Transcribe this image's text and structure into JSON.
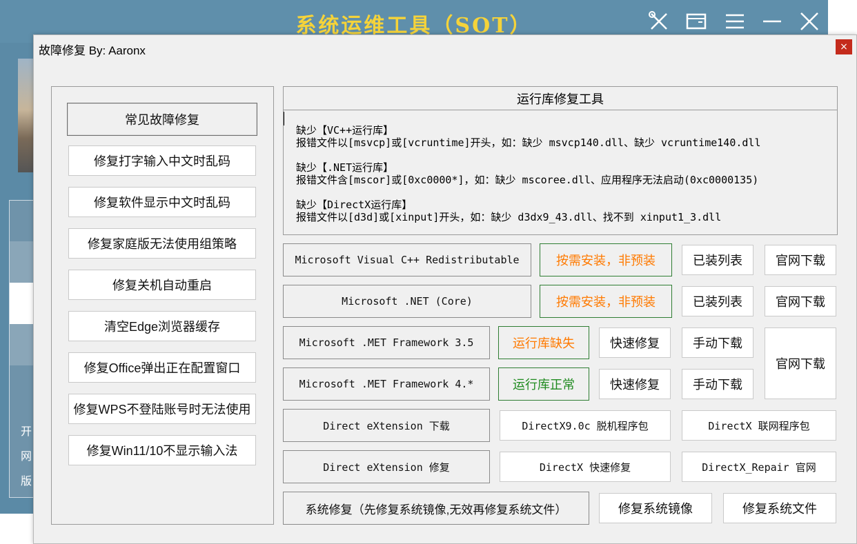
{
  "background_app": {
    "title": "系统运维工具（SOT）",
    "controls": [
      "tools-icon",
      "window-icon",
      "menu-icon",
      "minimize-icon",
      "close-icon"
    ],
    "side_text": [
      "开",
      "网",
      "版"
    ]
  },
  "dialog": {
    "title": "故障修复   By: Aaronx",
    "close_glyph": "×",
    "left_buttons": [
      "常见故障修复",
      "修复打字输入中文时乱码",
      "修复软件显示中文时乱码",
      "修复家庭版无法使用组策略",
      "修复关机自动重启",
      "清空Edge浏览器缓存",
      "修复Office弹出正在配置窗口",
      "修复WPS不登陆账号时无法使用",
      "修复Win11/10不显示输入法"
    ],
    "runtime": {
      "header": "运行库修复工具",
      "lines": [
        "缺少【VC++运行库】",
        "报错文件以[msvcp]或[vcruntime]开头，如：缺少 msvcp140.dll、缺少 vcruntime140.dll",
        "缺少【.NET运行库】",
        "报错文件含[mscor]或[0xc0000*]，如：缺少 mscoree.dll、应用程序无法启动(0xc0000135)",
        "缺少【DirectX运行库】",
        "报错文件以[d3d]或[xinput]开头，如：缺少 d3dx9_43.dll、找不到 xinput1_3.dll"
      ]
    },
    "rows": {
      "vcpp": {
        "label": "Microsoft Visual C++ Redistributable",
        "status": "按需安装，非预装",
        "list": "已装列表",
        "official": "官网下载"
      },
      "netcore": {
        "label": "Microsoft .NET (Core)",
        "status": "按需安装，非预装",
        "list": "已装列表",
        "official": "官网下载"
      },
      "net35": {
        "label": "Microsoft .MET Framework 3.5",
        "status": "运行库缺失",
        "quick": "快速修复",
        "manual": "手动下载"
      },
      "net4": {
        "label": "Microsoft .MET Framework 4.*",
        "status": "运行库正常",
        "quick": "快速修复",
        "manual": "手动下载"
      },
      "framework_official": "官网下载",
      "dx_download": {
        "label": "Direct eXtension 下载",
        "offline": "DirectX9.0c 脱机程序包",
        "online": "DirectX 联网程序包"
      },
      "dx_repair": {
        "label": "Direct eXtension 修复",
        "quick": "DirectX 快速修复",
        "site": "DirectX_Repair 官网"
      },
      "system": {
        "label": "系统修复（先修复系统镜像,无效再修复系统文件）",
        "image": "修复系统镜像",
        "files": "修复系统文件"
      }
    }
  },
  "colors": {
    "orange": "#ff7a00",
    "green": "#1f8a1f",
    "title_yellow": "#f5d33a",
    "close_red": "#c42b1c"
  }
}
